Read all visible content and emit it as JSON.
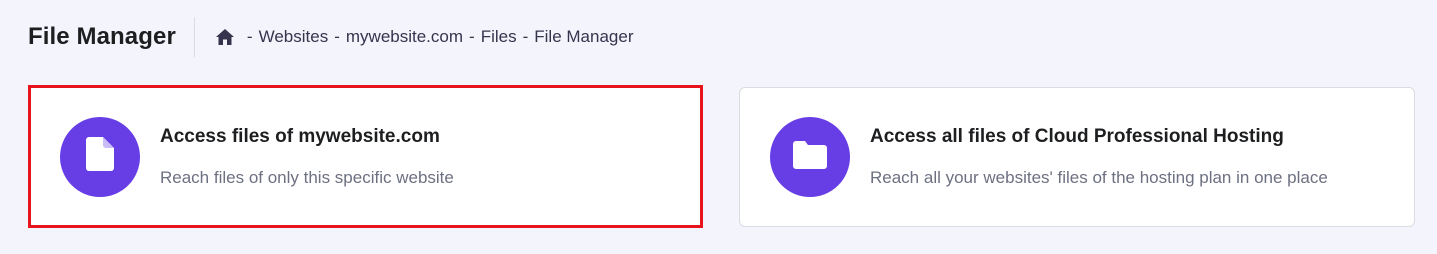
{
  "header": {
    "title": "File Manager",
    "breadcrumb": [
      "Websites",
      "mywebsite.com",
      "Files",
      "File Manager"
    ],
    "separator": "-"
  },
  "cards": [
    {
      "title": "Access files of mywebsite.com",
      "description": "Reach files of only this specific website",
      "icon": "file-icon",
      "selected": true
    },
    {
      "title": "Access all files of Cloud Professional Hosting",
      "description": "Reach all your websites' files of the hosting plan in one place",
      "icon": "folder-icon",
      "selected": false
    }
  ],
  "colors": {
    "accent": "#673de6",
    "highlight_border": "#e8141c",
    "background": "#f4f4fd"
  }
}
